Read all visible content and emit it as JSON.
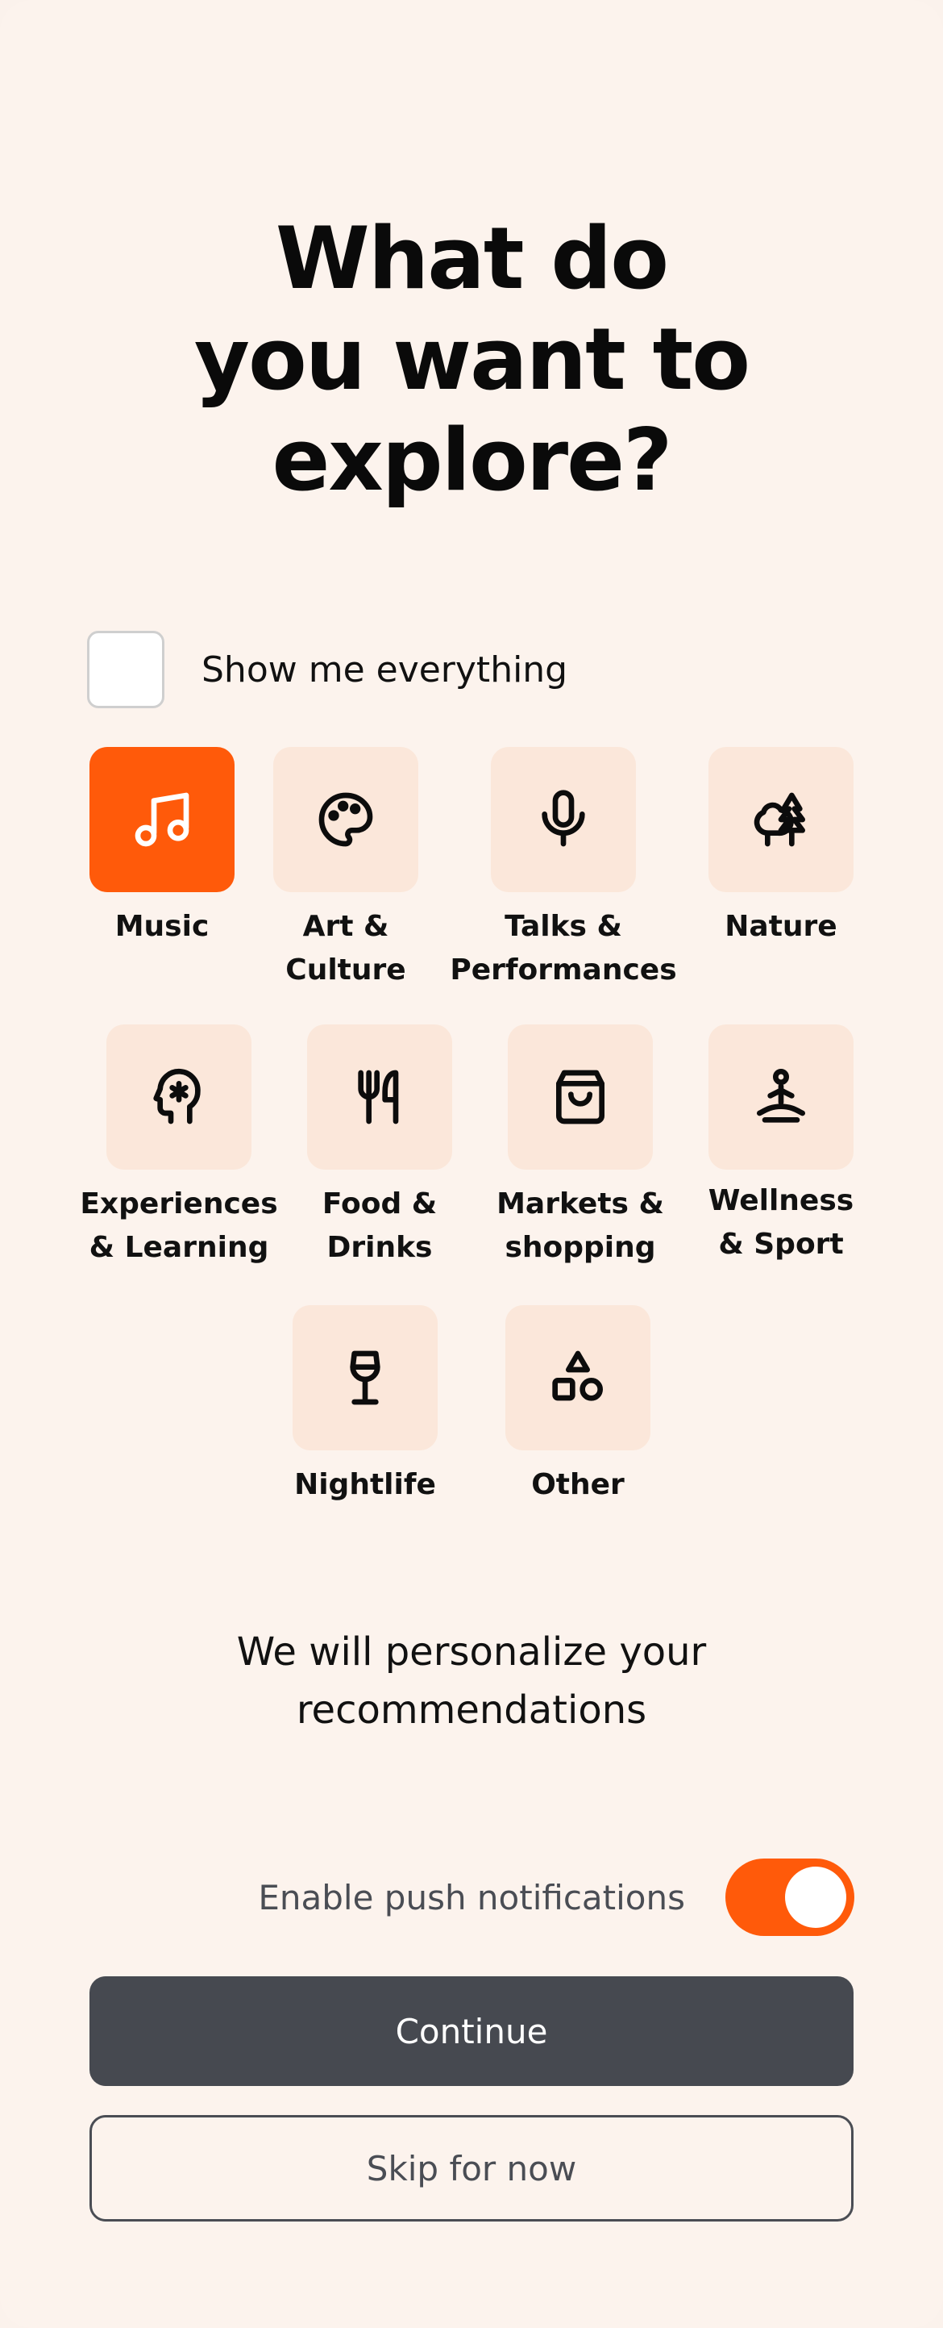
{
  "title_lines": [
    "What do",
    "you want to",
    "explore?"
  ],
  "show_all": {
    "label": "Show me everything",
    "checked": false
  },
  "categories": [
    {
      "id": "music",
      "label_lines": [
        "Music"
      ],
      "icon": "music-note-icon",
      "selected": true
    },
    {
      "id": "art-culture",
      "label_lines": [
        "Art &",
        "Culture"
      ],
      "icon": "palette-icon",
      "selected": false
    },
    {
      "id": "talks",
      "label_lines": [
        "Talks &",
        "Performances"
      ],
      "icon": "microphone-icon",
      "selected": false
    },
    {
      "id": "nature",
      "label_lines": [
        "Nature"
      ],
      "icon": "trees-icon",
      "selected": false
    },
    {
      "id": "experiences",
      "label_lines": [
        "Experiences",
        "& Learning"
      ],
      "icon": "head-brain-icon",
      "selected": false
    },
    {
      "id": "food",
      "label_lines": [
        "Food &",
        "Drinks"
      ],
      "icon": "fork-knife-icon",
      "selected": false
    },
    {
      "id": "markets",
      "label_lines": [
        "Markets &",
        "shopping"
      ],
      "icon": "shopping-bag-icon",
      "selected": false
    },
    {
      "id": "wellness",
      "label_lines": [
        "Wellness",
        "& Sport"
      ],
      "icon": "yoga-icon",
      "selected": false
    },
    {
      "id": "nightlife",
      "label_lines": [
        "Nightlife"
      ],
      "icon": "wine-glass-icon",
      "selected": false
    },
    {
      "id": "other",
      "label_lines": [
        "Other"
      ],
      "icon": "shapes-icon",
      "selected": false
    }
  ],
  "personalize_lines": [
    "We will personalize your",
    "recommendations"
  ],
  "push": {
    "label": "Enable push notifications",
    "enabled": true
  },
  "buttons": {
    "continue": "Continue",
    "skip": "Skip for now"
  },
  "colors": {
    "accent": "#ff5a0a",
    "tile": "#fbe7da",
    "background": "#fcf3ed",
    "primary_button": "#464950"
  }
}
